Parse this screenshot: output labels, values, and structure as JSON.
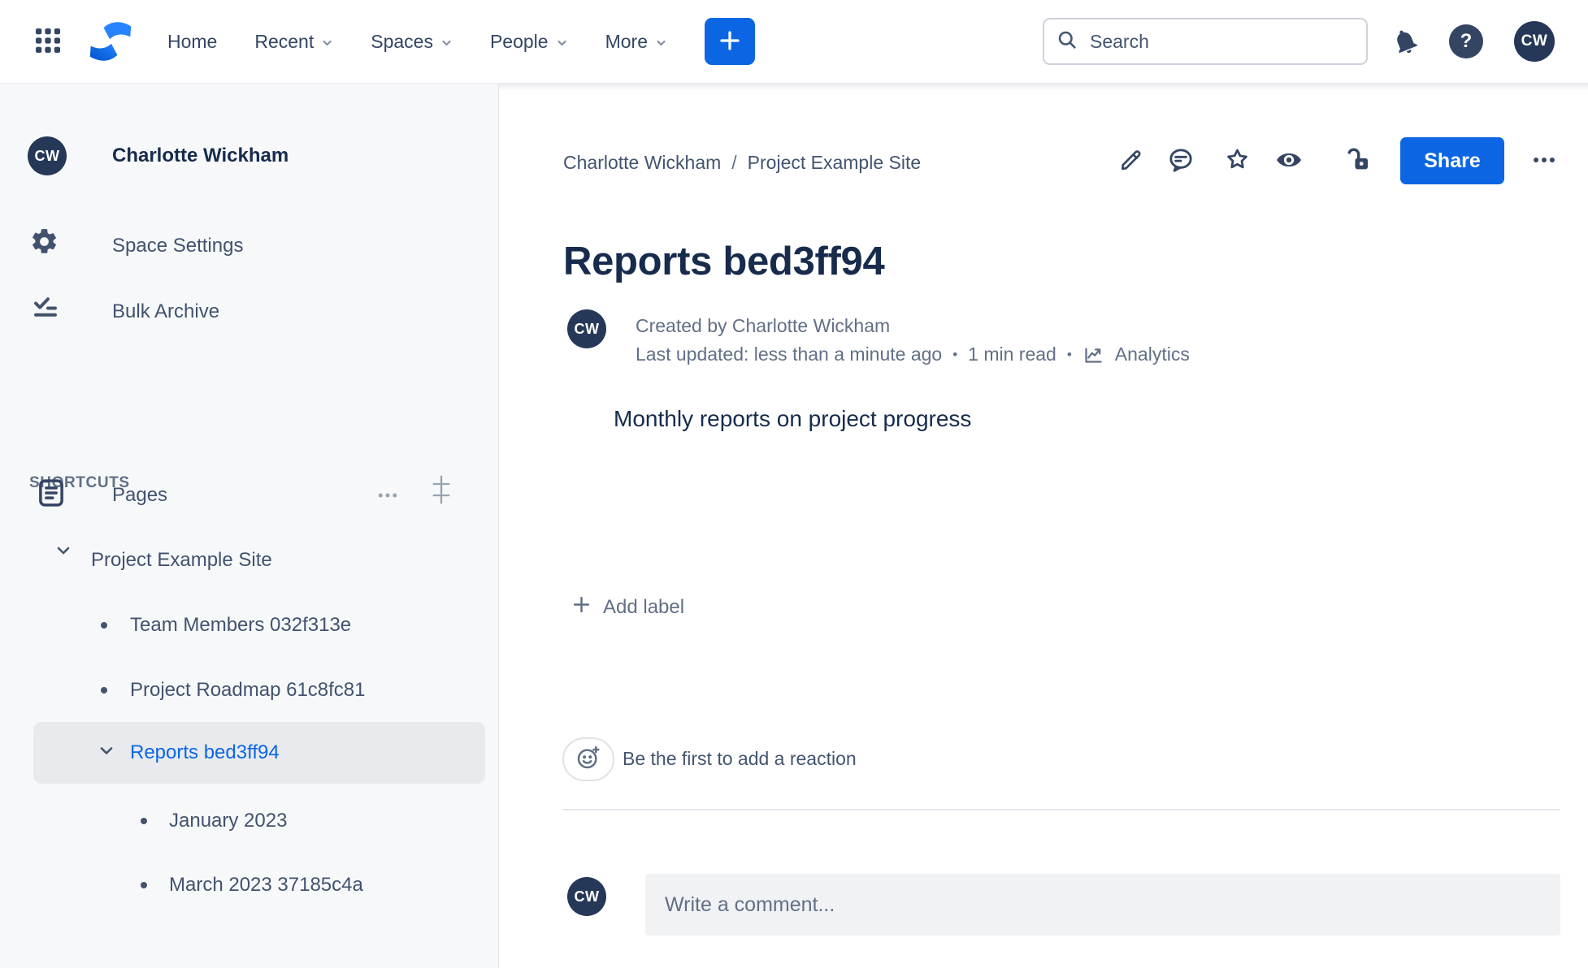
{
  "colors": {
    "brand_blue": "#0C66E4",
    "logo_blue_light": "#2684FF",
    "logo_blue_dark": "#0052CC",
    "heading_text": "#172B4D",
    "nav_text": "#344563",
    "muted_text": "#626F86",
    "sidebar_bg": "#F7F8F9",
    "selected_row_bg": "#E8EAEE",
    "selected_text": "#0C66E4",
    "avatar_bg": "#253858",
    "comment_input_bg": "#F1F2F4"
  },
  "topbar": {
    "nav": [
      {
        "label": "Home"
      },
      {
        "label": "Recent"
      },
      {
        "label": "Spaces"
      },
      {
        "label": "People"
      },
      {
        "label": "More"
      }
    ],
    "search": {
      "placeholder": "Search"
    },
    "help_glyph": "?",
    "avatar_initials": "CW"
  },
  "sidebar": {
    "space_avatar_initials": "CW",
    "space_name": "Charlotte Wickham",
    "menu": [
      {
        "label": "Space Settings"
      },
      {
        "label": "Bulk Archive"
      }
    ],
    "shortcuts_header": "SHORTCUTS",
    "pages_header": "Pages",
    "tree": {
      "root_label": "Project Example Site",
      "items": [
        {
          "label": "Team Members 032f313e"
        },
        {
          "label": "Project Roadmap 61c8fc81"
        },
        {
          "label": "Reports bed3ff94"
        },
        {
          "label": "January 2023"
        },
        {
          "label": "March 2023 37185c4a"
        }
      ]
    }
  },
  "content": {
    "breadcrumb": {
      "items": [
        {
          "label": "Charlotte Wickham"
        },
        {
          "label": "Project Example Site"
        }
      ],
      "separator": "/"
    },
    "actions": {
      "share_label": "Share"
    },
    "title": "Reports bed3ff94",
    "byline": {
      "avatar_initials": "CW",
      "created": "Created by Charlotte Wickham",
      "updated": "Last updated: less than a minute ago",
      "dot": "•",
      "read_time": "1 min read",
      "analytics_label": "Analytics"
    },
    "body_text": "Monthly reports on project progress",
    "add_label": {
      "label": "Add label"
    },
    "reactions": {
      "prompt": "Be the first to add a reaction"
    },
    "comments": {
      "avatar_initials": "CW",
      "placeholder": "Write a comment..."
    }
  }
}
